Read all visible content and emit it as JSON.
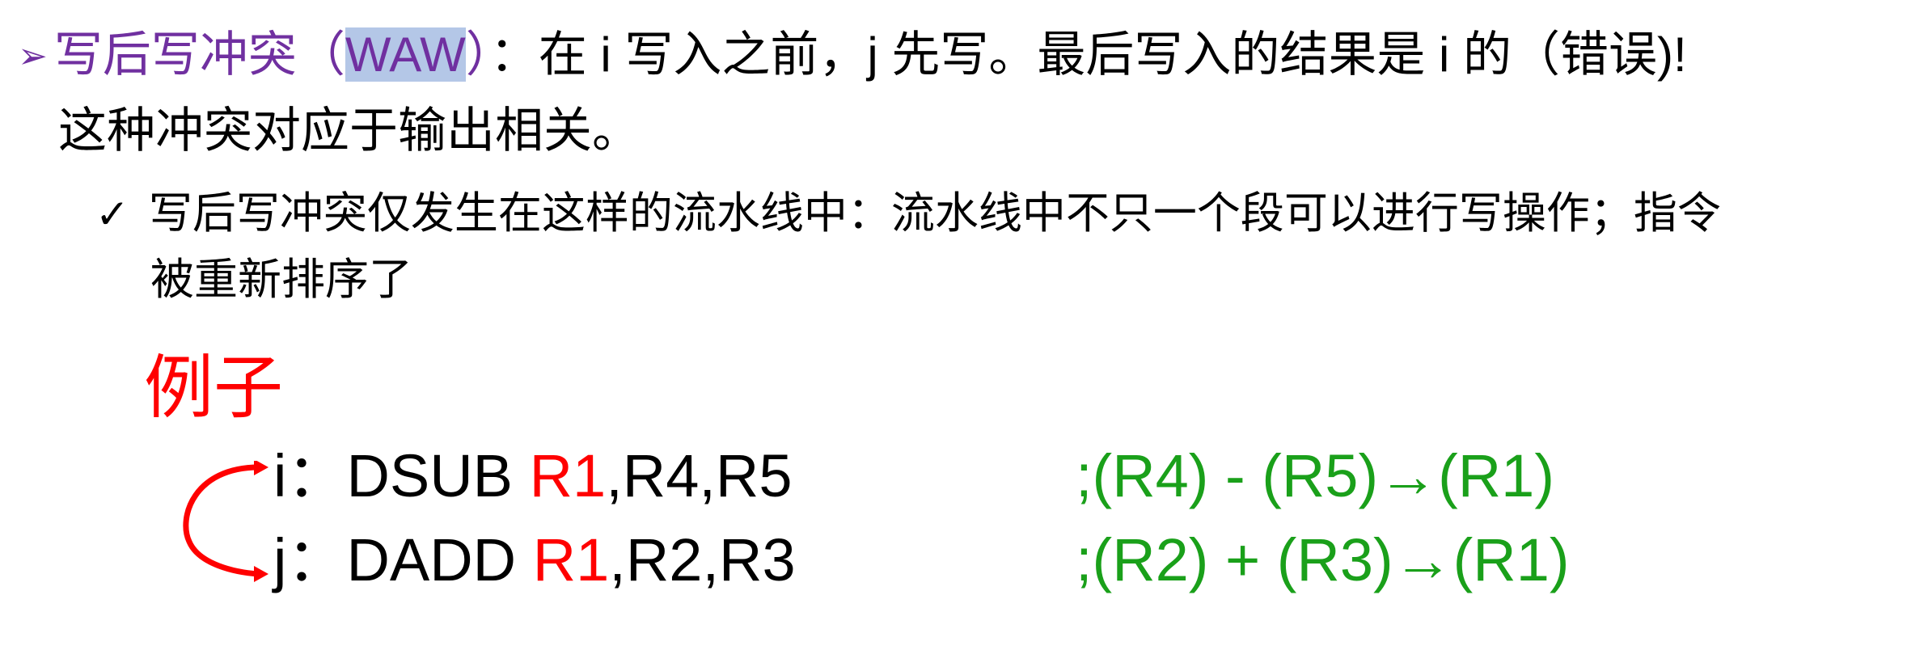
{
  "line1": {
    "bullet": "➢",
    "title": "写后写冲突（",
    "highlight": "WAW",
    "close": "）",
    "rest": "：在 i 写入之前，j 先写。最后写入的结果是 i 的（错误)!"
  },
  "line2": "这种冲突对应于输出相关。",
  "sub": {
    "check": "✓",
    "text1": "写后写冲突仅发生在这样的流水线中：流水线中不只一个段可以进行写操作；指令",
    "text2": "被重新排序了"
  },
  "example": {
    "title": "例子",
    "instr_i": {
      "label": "i：DSUB ",
      "reg": "R1",
      "rest": ",R4,R5",
      "comment": ";(R4) - (R5)→(R1)"
    },
    "instr_j": {
      "label": "j：DADD ",
      "reg": "R1",
      "rest": ",R2,R3",
      "comment": ";(R2) + (R3)→(R1)"
    }
  },
  "colors": {
    "purple": "#7030a0",
    "highlight": "#b4c7e7",
    "red": "#ff0000",
    "green": "#1aa01a"
  },
  "icons": {
    "bullet": "arrow-bullet-icon",
    "check": "check-icon",
    "curved_arrow": "curved-arrow-icon"
  }
}
